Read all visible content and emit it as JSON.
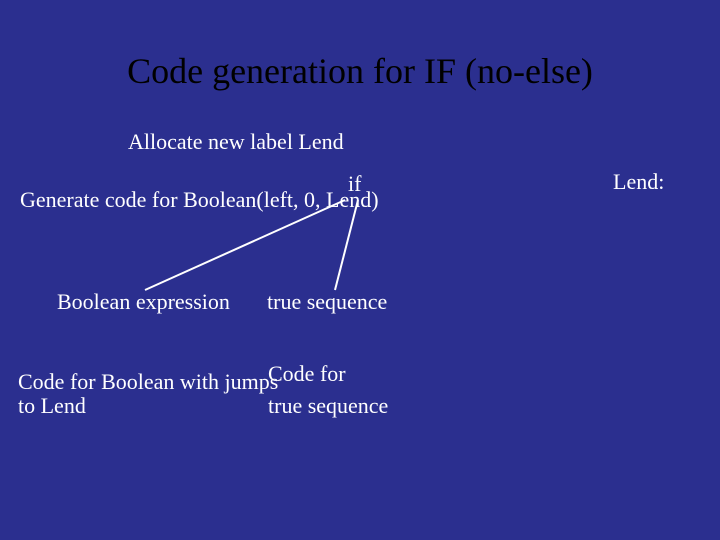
{
  "title": "Code generation for IF (no-else)",
  "text": {
    "allocate": "Allocate new label Lend",
    "if": "if",
    "generate": "Generate code for Boolean(left, 0, Lend)",
    "lend": "Lend:",
    "bool_expr": "Boolean expression",
    "true_seq": "true sequence",
    "code_bool_jumps_l1": "Code for Boolean with jumps",
    "code_bool_jumps_l2": "to Lend",
    "code_for": "Code for",
    "true_seq2": "true sequence"
  }
}
